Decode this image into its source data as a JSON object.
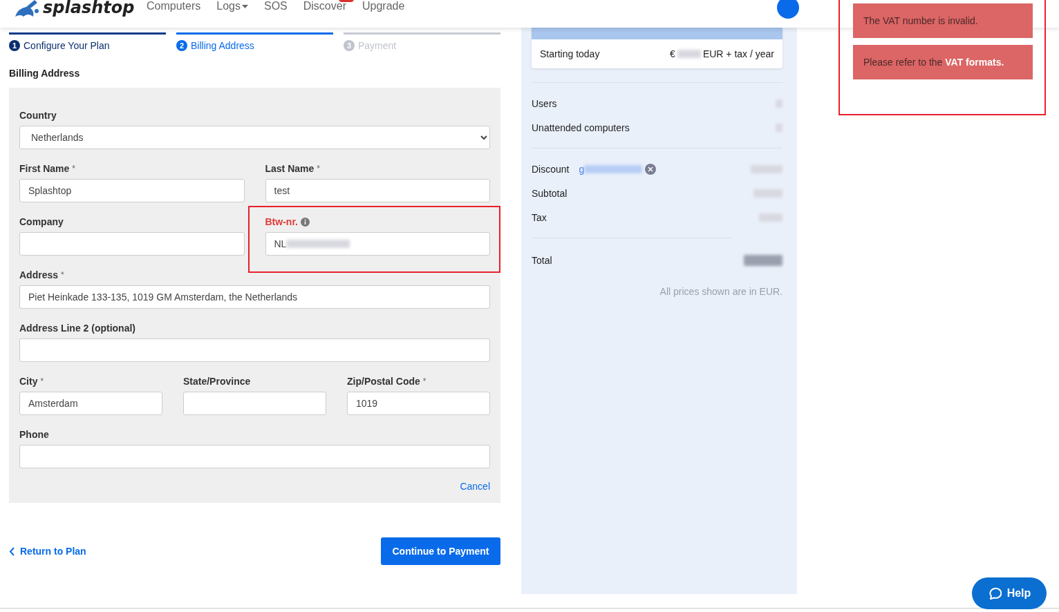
{
  "nav": {
    "logo_text": "splashtop",
    "items": [
      {
        "label": "Computers",
        "dropdown": false
      },
      {
        "label": "Logs",
        "dropdown": true
      },
      {
        "label": "SOS",
        "dropdown": false
      },
      {
        "label": "Discover",
        "dropdown": false,
        "badge": true
      },
      {
        "label": "Upgrade",
        "dropdown": false
      }
    ]
  },
  "steps": [
    {
      "number": "1",
      "label": "Configure Your Plan",
      "completed": true,
      "selected": false
    },
    {
      "number": "2",
      "label": "Billing Address",
      "completed": false,
      "selected": true
    },
    {
      "number": "3",
      "label": "Payment",
      "completed": false,
      "selected": false
    }
  ],
  "section_title": "Billing Address",
  "form": {
    "rows": [
      [
        {
          "label": "Country",
          "kind": "select",
          "value": "Netherlands",
          "invalid": false,
          "highlighted": false
        }
      ],
      [
        {
          "label": "First Name",
          "required_mark": "*",
          "kind": "text",
          "value": "Splashtop",
          "invalid": false,
          "highlighted": false
        },
        {
          "label": "Last Name",
          "required_mark": "*",
          "kind": "text",
          "value": "test",
          "invalid": false,
          "highlighted": false
        }
      ],
      [
        {
          "label": "Company",
          "kind": "text",
          "invalid": false,
          "highlighted": false
        },
        {
          "label": "Btw-nr.",
          "kind": "text",
          "info": true,
          "value": "NL",
          "value_blurred": true,
          "invalid": true,
          "highlighted": true
        }
      ],
      [
        {
          "label": "Address",
          "required_mark": "*",
          "kind": "text",
          "value": "Piet Heinkade 133-135, 1019 GM Amsterdam, the Netherlands",
          "invalid": false,
          "highlighted": false
        }
      ],
      [
        {
          "label": "Address Line 2 (optional)",
          "kind": "text",
          "invalid": false,
          "highlighted": false
        }
      ],
      [
        {
          "label": "City",
          "required_mark": "*",
          "kind": "text",
          "value": "Amsterdam",
          "invalid": false,
          "highlighted": false
        },
        {
          "label": "State/Province",
          "kind": "text",
          "invalid": false,
          "highlighted": false
        },
        {
          "label": "Zip/Postal Code",
          "required_mark": "*",
          "kind": "text",
          "value": "1019",
          "invalid": false,
          "highlighted": false
        }
      ],
      [
        {
          "label": "Phone",
          "kind": "text",
          "invalid": false,
          "highlighted": false
        }
      ]
    ],
    "cancel": "Cancel"
  },
  "back_link": "Return to Plan",
  "continue_button": "Continue to Payment",
  "summary": {
    "price_row": {
      "label": "Starting today",
      "prefix": "€",
      "suffix": "EUR + tax / year"
    },
    "items": [
      {
        "label": "Users",
        "value_blurred": true
      },
      {
        "label": "Unattended computers",
        "value_blurred": true
      }
    ],
    "totals": [
      {
        "label": "Discount",
        "code_prefix": "g",
        "value_blurred": true
      },
      {
        "label": "Subtotal",
        "value_blurred": true
      },
      {
        "label": "Tax",
        "value_blurred": true
      }
    ],
    "total_label": "Total",
    "note": "All prices shown are in EUR."
  },
  "notifications": {
    "highlighted": true,
    "items": [
      {
        "text": "The VAT number is invalid."
      },
      {
        "text": "Please refer to the **VAT formats.**"
      }
    ]
  },
  "help_button": "Help"
}
